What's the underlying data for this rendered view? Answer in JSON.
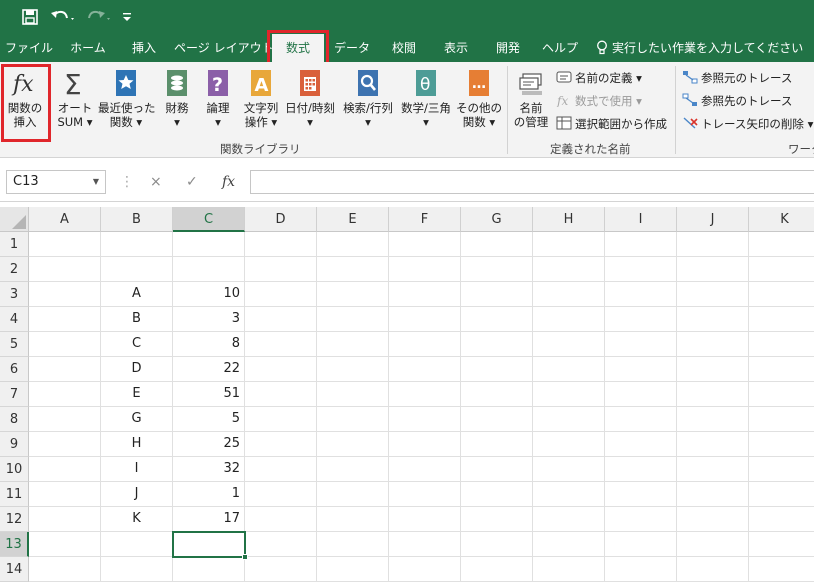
{
  "quick_access": {
    "save_icon": "save-icon",
    "undo_icon": "undo-icon",
    "redo_icon": "redo-icon",
    "customize_icon": "customize-quick-access-icon"
  },
  "tabs": [
    {
      "label": "ファイル"
    },
    {
      "label": "ホーム"
    },
    {
      "label": "挿入"
    },
    {
      "label": "ページ レイアウト"
    },
    {
      "label": "数式"
    },
    {
      "label": "データ"
    },
    {
      "label": "校閲"
    },
    {
      "label": "表示"
    },
    {
      "label": "開発"
    },
    {
      "label": "ヘルプ"
    }
  ],
  "tell_me": "実行したい作業を入力してください",
  "ribbon": {
    "function_library": {
      "group_label": "関数ライブラリ",
      "buttons": [
        {
          "line1": "関数の",
          "line2": "挿入",
          "icon": "fx-icon"
        },
        {
          "line1": "オート",
          "line2": "SUM ▾",
          "icon": "sigma-icon"
        },
        {
          "line1": "最近使った",
          "line2": "関数 ▾",
          "icon": "star-book-icon"
        },
        {
          "line1": "財務",
          "line2": "▾",
          "icon": "finance-icon"
        },
        {
          "line1": "論理",
          "line2": "▾",
          "icon": "logical-icon"
        },
        {
          "line1": "文字列",
          "line2": "操作 ▾",
          "icon": "text-icon"
        },
        {
          "line1": "日付/時刻",
          "line2": "▾",
          "icon": "calendar-icon"
        },
        {
          "line1": "検索/行列",
          "line2": "▾",
          "icon": "lookup-icon"
        },
        {
          "line1": "数学/三角",
          "line2": "▾",
          "icon": "theta-icon"
        },
        {
          "line1": "その他の",
          "line2": "関数 ▾",
          "icon": "more-functions-icon"
        }
      ]
    },
    "defined_names": {
      "group_label": "定義された名前",
      "name_manager": {
        "line1": "名前",
        "line2": "の管理"
      },
      "items": [
        {
          "label": "名前の定義 ▾",
          "disabled": false
        },
        {
          "label": "数式で使用 ▾",
          "disabled": true
        },
        {
          "label": "選択範囲から作成",
          "disabled": false
        }
      ]
    },
    "formula_auditing": {
      "group_label": "ワーク",
      "items": [
        {
          "label": "参照元のトレース"
        },
        {
          "label": "参照先のトレース"
        },
        {
          "label": "トレース矢印の削除 ▾"
        }
      ]
    }
  },
  "formula_bar": {
    "name_box": "C13",
    "cancel_icon": "×",
    "enter_icon": "✓",
    "fx_label": "fx",
    "formula": ""
  },
  "sheet": {
    "columns": [
      "A",
      "B",
      "C",
      "D",
      "E",
      "F",
      "G",
      "H",
      "I",
      "J",
      "K"
    ],
    "rows": [
      "1",
      "2",
      "3",
      "4",
      "5",
      "6",
      "7",
      "8",
      "9",
      "10",
      "11",
      "12",
      "13",
      "14"
    ],
    "data": [
      {
        "row": 3,
        "label": "A",
        "value": "10"
      },
      {
        "row": 4,
        "label": "B",
        "value": "3"
      },
      {
        "row": 5,
        "label": "C",
        "value": "8"
      },
      {
        "row": 6,
        "label": "D",
        "value": "22"
      },
      {
        "row": 7,
        "label": "E",
        "value": "51"
      },
      {
        "row": 8,
        "label": "G",
        "value": "5"
      },
      {
        "row": 9,
        "label": "H",
        "value": "25"
      },
      {
        "row": 10,
        "label": "I",
        "value": "32"
      },
      {
        "row": 11,
        "label": "J",
        "value": "1"
      },
      {
        "row": 12,
        "label": "K",
        "value": "17"
      }
    ],
    "selected_cell": "C13"
  },
  "colors": {
    "excel_green": "#217346",
    "highlight_red": "#e0262b"
  }
}
